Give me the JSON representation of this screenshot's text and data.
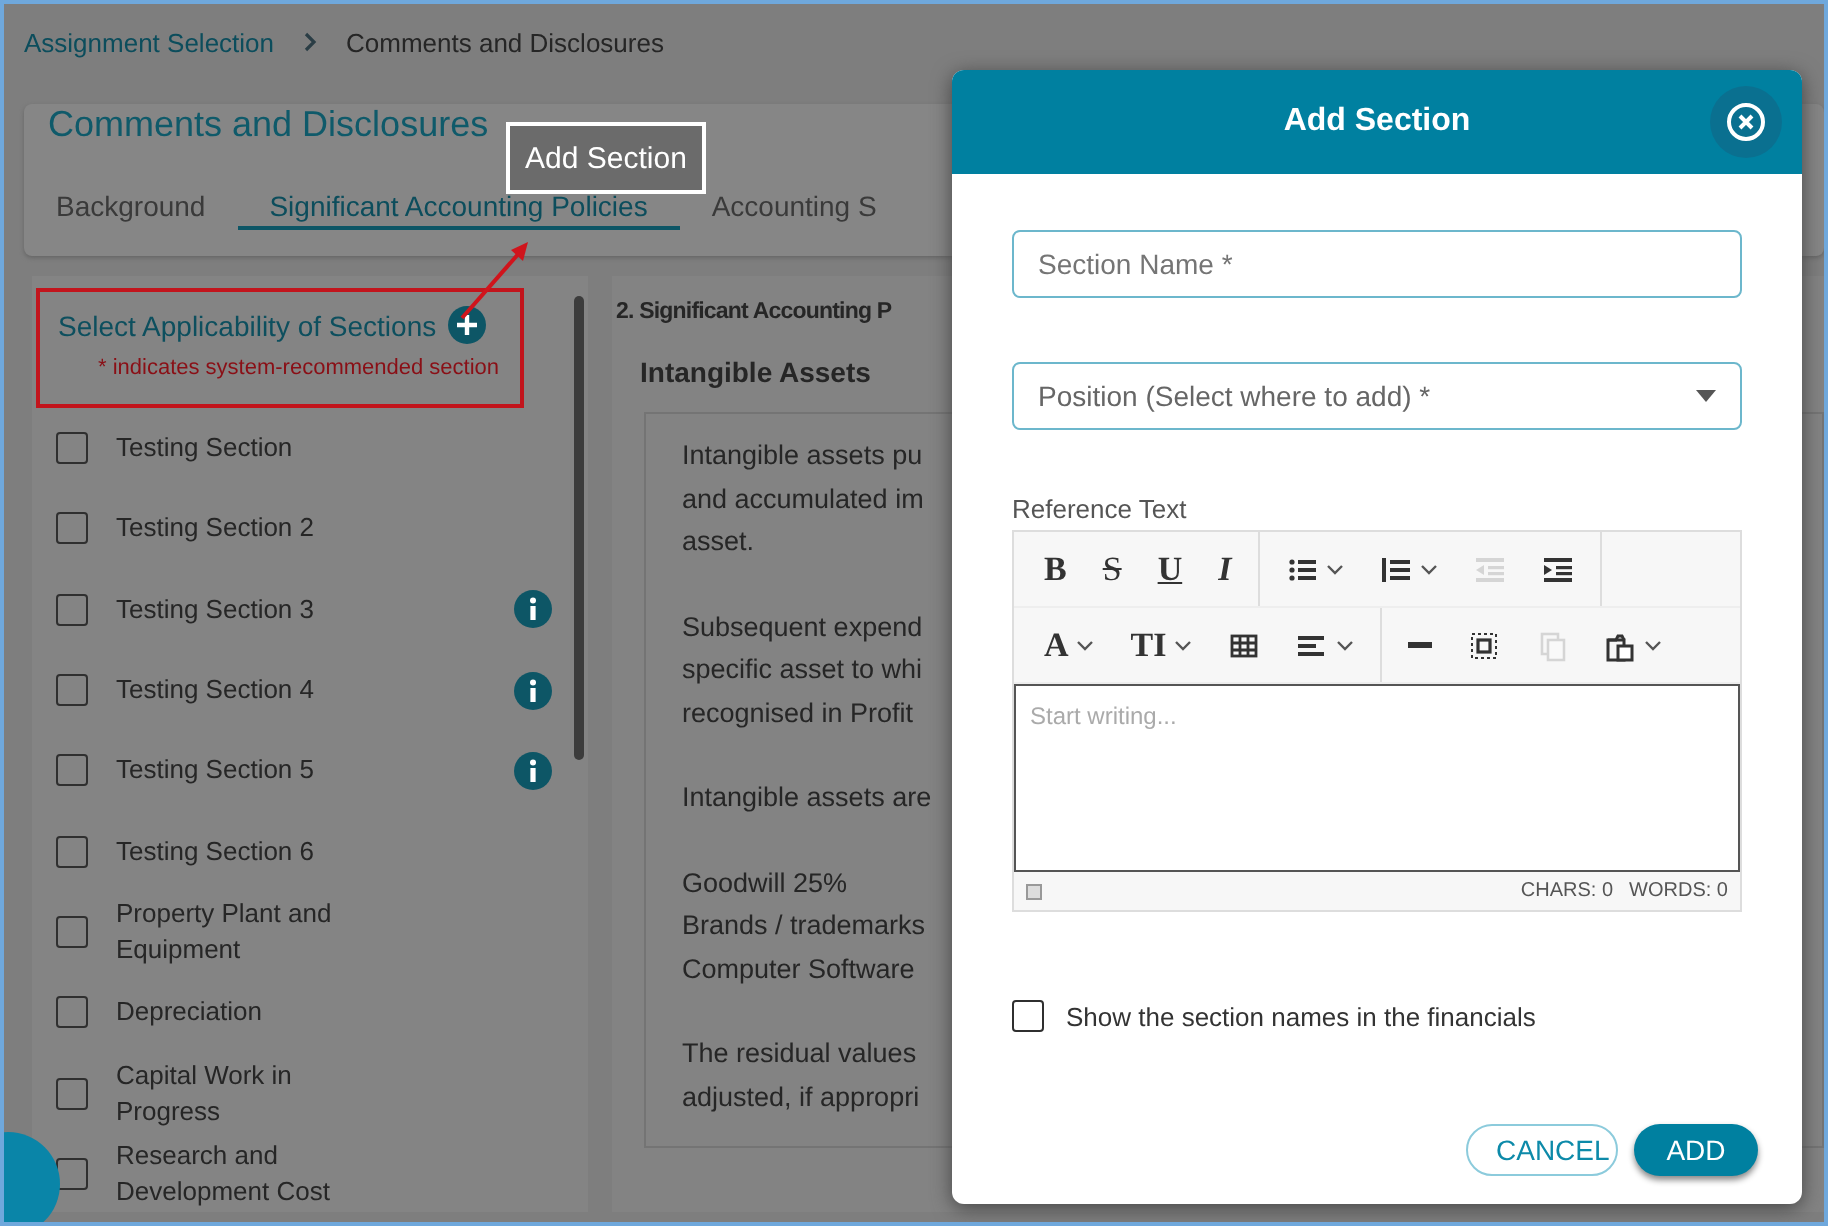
{
  "breadcrumb": [
    {
      "label": "Assignment Selection",
      "kind": "link"
    },
    {
      "label": "Comments and Disclosures",
      "kind": "current"
    }
  ],
  "page": {
    "title": "Comments and Disclosures",
    "tabs": [
      {
        "label": "Background",
        "selected": false
      },
      {
        "label": "Significant Accounting Policies",
        "selected": true
      },
      {
        "label": "Accounting S",
        "selected": false
      }
    ]
  },
  "sections_panel": {
    "title": "Select Applicability of Sections",
    "note": "* indicates system-recommended section",
    "items": [
      {
        "label": "Testing Section",
        "checked": false,
        "info": false
      },
      {
        "label": "Testing Section 2",
        "checked": false,
        "info": false
      },
      {
        "label": "Testing Section 3",
        "checked": false,
        "info": true
      },
      {
        "label": "Testing Section 4",
        "checked": false,
        "info": true
      },
      {
        "label": "Testing Section 5",
        "checked": false,
        "info": true
      },
      {
        "label": "Testing Section 6",
        "checked": false,
        "info": false
      },
      {
        "label": "Property Plant and Equipment",
        "checked": false,
        "info": false
      },
      {
        "label": "Depreciation",
        "checked": false,
        "info": false
      },
      {
        "label": "Capital Work in Progress",
        "checked": false,
        "info": false
      },
      {
        "label": "Research and Development Cost",
        "checked": false,
        "info": false
      }
    ]
  },
  "content": {
    "heading": "2. Significant Accounting P",
    "subheading": "Intangible Assets",
    "paragraphs": [
      [
        "Intangible assets pu",
        "and accumulated im",
        "asset."
      ],
      [
        "Subsequent expend",
        "specific asset to whi",
        "recognised in Profit"
      ],
      [
        "Intangible assets are"
      ],
      [
        "Goodwill 25%",
        "Brands / trademarks",
        "Computer Software"
      ],
      [
        "The residual values",
        "adjusted, if appropri"
      ]
    ]
  },
  "callout": {
    "label": "Add Section"
  },
  "dialog": {
    "title": "Add Section",
    "fields": [
      {
        "kind": "text",
        "placeholder": "Section Name *"
      },
      {
        "kind": "select",
        "placeholder": "Position (Select where to add) *"
      }
    ],
    "editor": {
      "label": "Reference Text",
      "placeholder": "Start writing...",
      "chars": "CHARS: 0",
      "words": "WORDS: 0",
      "toolbar": [
        [
          {
            "kind": "bold",
            "glyph": "B",
            "dropdown": false,
            "disabled": false
          },
          {
            "kind": "strike",
            "glyph": "S",
            "dropdown": false,
            "disabled": false
          },
          {
            "kind": "underline",
            "glyph": "U",
            "dropdown": false,
            "disabled": false
          },
          {
            "kind": "italic",
            "glyph": "I",
            "dropdown": false,
            "disabled": false
          },
          {
            "kind": "sep"
          },
          {
            "kind": "bullets",
            "dropdown": true,
            "disabled": false
          },
          {
            "kind": "numbers",
            "dropdown": true,
            "disabled": false
          },
          {
            "kind": "outdent",
            "dropdown": false,
            "disabled": true
          },
          {
            "kind": "indent",
            "dropdown": false,
            "disabled": false
          },
          {
            "kind": "sep"
          }
        ],
        [
          {
            "kind": "color",
            "glyph": "A",
            "dropdown": true,
            "disabled": false
          },
          {
            "kind": "size",
            "glyph": "TI",
            "dropdown": true,
            "disabled": false
          },
          {
            "kind": "table",
            "dropdown": false,
            "disabled": false
          },
          {
            "kind": "align",
            "dropdown": true,
            "disabled": false
          },
          {
            "kind": "sep"
          },
          {
            "kind": "rule",
            "dropdown": false,
            "disabled": false
          },
          {
            "kind": "selectall",
            "dropdown": false,
            "disabled": false
          },
          {
            "kind": "copy",
            "dropdown": false,
            "disabled": true
          },
          {
            "kind": "paste",
            "dropdown": true,
            "disabled": false
          }
        ]
      ]
    },
    "checkbox": {
      "label": "Show the section names in the financials",
      "checked": false
    },
    "buttons": [
      {
        "label": "CANCEL",
        "kind": "secondary"
      },
      {
        "label": "ADD",
        "kind": "primary"
      }
    ]
  }
}
